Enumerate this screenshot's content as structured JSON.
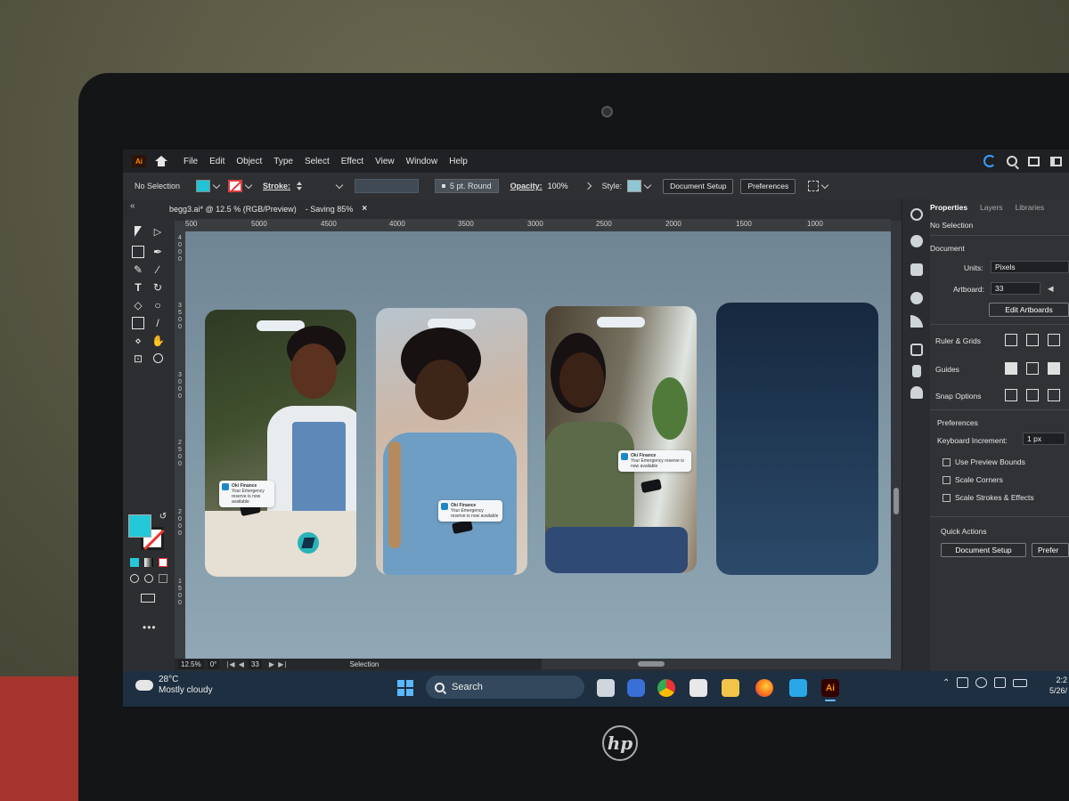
{
  "menu": {
    "items": [
      "File",
      "Edit",
      "Object",
      "Type",
      "Select",
      "Effect",
      "View",
      "Window",
      "Help"
    ]
  },
  "control_bar": {
    "selection": "No Selection",
    "stroke_label": "Stroke:",
    "brush": "5 pt. Round",
    "opacity_label": "Opacity:",
    "opacity_value": "100%",
    "style_label": "Style:",
    "document_setup": "Document Setup",
    "preferences": "Preferences"
  },
  "document_tab": {
    "title": "begg3.ai* @ 12.5 % (RGB/Preview)",
    "saving": "- Saving 85%",
    "close": "×"
  },
  "ruler": {
    "horizontal": [
      "500",
      "5000",
      "4500",
      "4000",
      "3500",
      "3000",
      "2500",
      "2000",
      "1500",
      "1000"
    ],
    "vertical": [
      [
        "4",
        "0",
        "0",
        "0"
      ],
      [
        "3",
        "5",
        "0",
        "0"
      ],
      [
        "3",
        "0",
        "0",
        "0"
      ],
      [
        "2",
        "5",
        "0",
        "0"
      ],
      [
        "2",
        "0",
        "0",
        "0"
      ],
      [
        "1",
        "5",
        "0",
        "0"
      ]
    ]
  },
  "artboards": {
    "notification_title": "Oki Finance",
    "notification_body": "Your Emergency reserve is now available"
  },
  "status_bar": {
    "zoom": "12.5%",
    "rotation": "0°",
    "artboard_number": "33",
    "tool": "Selection"
  },
  "properties_panel": {
    "tabs": [
      "Properties",
      "Layers",
      "Libraries"
    ],
    "selection": "No Selection",
    "document_heading": "Document",
    "units_label": "Units:",
    "units_value": "Pixels",
    "artboard_label": "Artboard:",
    "artboard_value": "33",
    "edit_artboards": "Edit Artboards",
    "rulers_grids": "Ruler & Grids",
    "guides": "Guides",
    "snap_options": "Snap Options",
    "preferences_heading": "Preferences",
    "keyboard_increment_label": "Keyboard Increment:",
    "keyboard_increment_value": "1 px",
    "checkboxes": [
      "Use Preview Bounds",
      "Scale Corners",
      "Scale Strokes & Effects"
    ],
    "quick_actions": "Quick Actions",
    "document_setup": "Document Setup",
    "preferences_button": "Prefer"
  },
  "taskbar": {
    "temperature": "28°C",
    "weather": "Mostly cloudy",
    "search": "Search",
    "ai_app": "Ai",
    "clock_time": "2:2",
    "clock_date": "5/26/"
  },
  "device": {
    "logo": "hp"
  },
  "colors": {
    "fill": "#25c8d8",
    "accent_blue": "#3b9cff",
    "panel_bg": "#303236",
    "taskbar_bg": "#1d2f40"
  }
}
